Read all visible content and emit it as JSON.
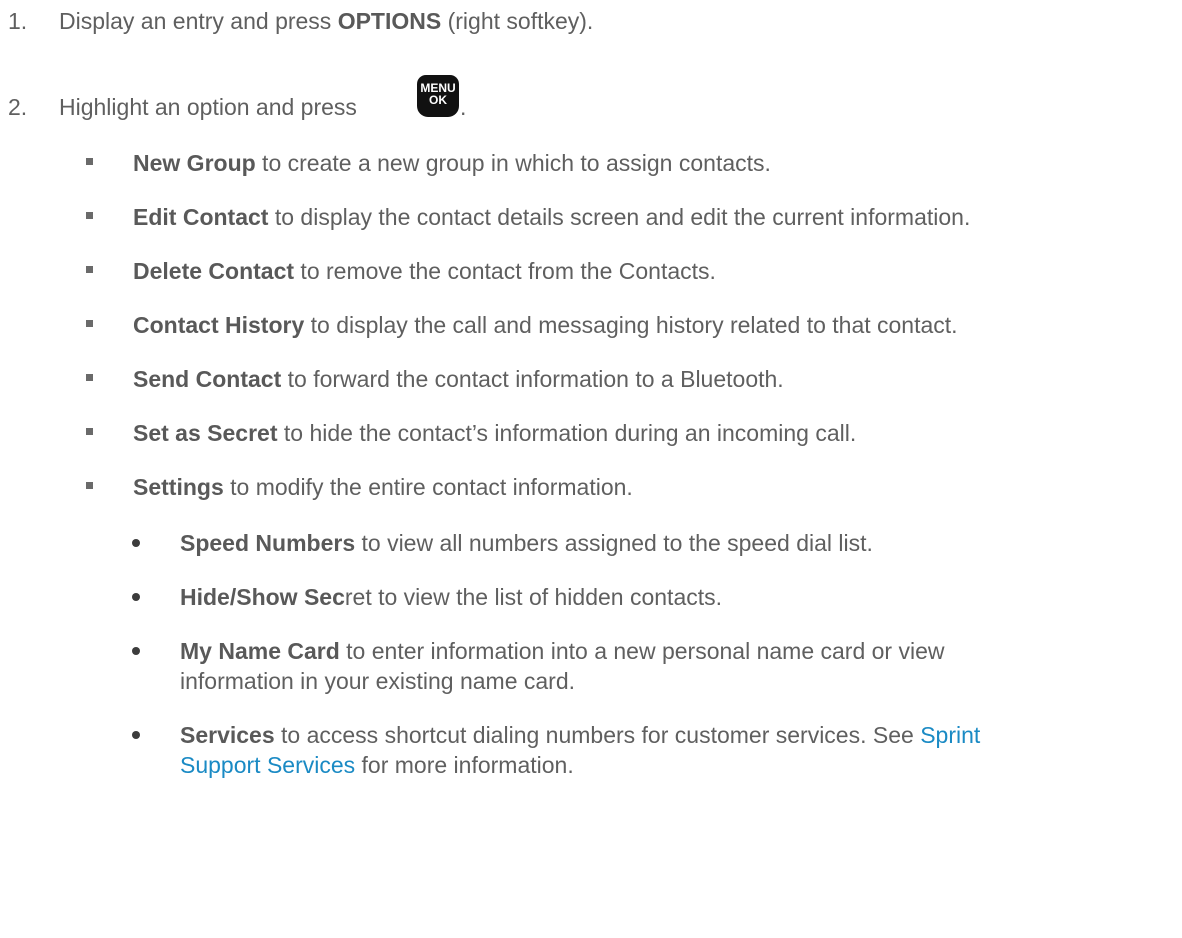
{
  "steps": [
    {
      "num": "1.",
      "pre": "Display an entry and press ",
      "bold": "OPTIONS",
      "post": " (right softkey)."
    },
    {
      "num": "2.",
      "pre": "Highlight an option and press ",
      "post": "."
    }
  ],
  "menu_key": {
    "line1": "MENU",
    "line2": "OK"
  },
  "options": [
    {
      "bold": "New Group",
      "text": " to create a new group in which to assign contacts."
    },
    {
      "bold": "Edit Contact",
      "text": " to display the contact details screen and edit the current information."
    },
    {
      "bold": "Delete Contact",
      "text": " to remove the contact from the Contacts."
    },
    {
      "bold": "Contact History",
      "text": " to display the call and messaging history related to that contact."
    },
    {
      "bold": "Send Contact",
      "text": " to forward the contact information to a Bluetooth."
    },
    {
      "bold": "Set as Secret",
      "text": " to hide the contact’s information during an incoming call."
    },
    {
      "bold": "Settings",
      "text": " to modify the entire contact information."
    }
  ],
  "settings": [
    {
      "bold": "Speed Numbers",
      "text": " to view all numbers assigned to the speed dial list."
    },
    {
      "bold": "Hide/Show Sec",
      "text": "ret to view the list of hidden contacts."
    },
    {
      "bold": "My Name Card",
      "text": " to enter information into a new personal name card or view",
      "text2": "information in your existing name card."
    },
    {
      "bold": "Services",
      "text": " to access shortcut dialing numbers for customer services. See ",
      "link1": "Sprint",
      "link2": "Support Services",
      "text2": " for more information."
    }
  ]
}
